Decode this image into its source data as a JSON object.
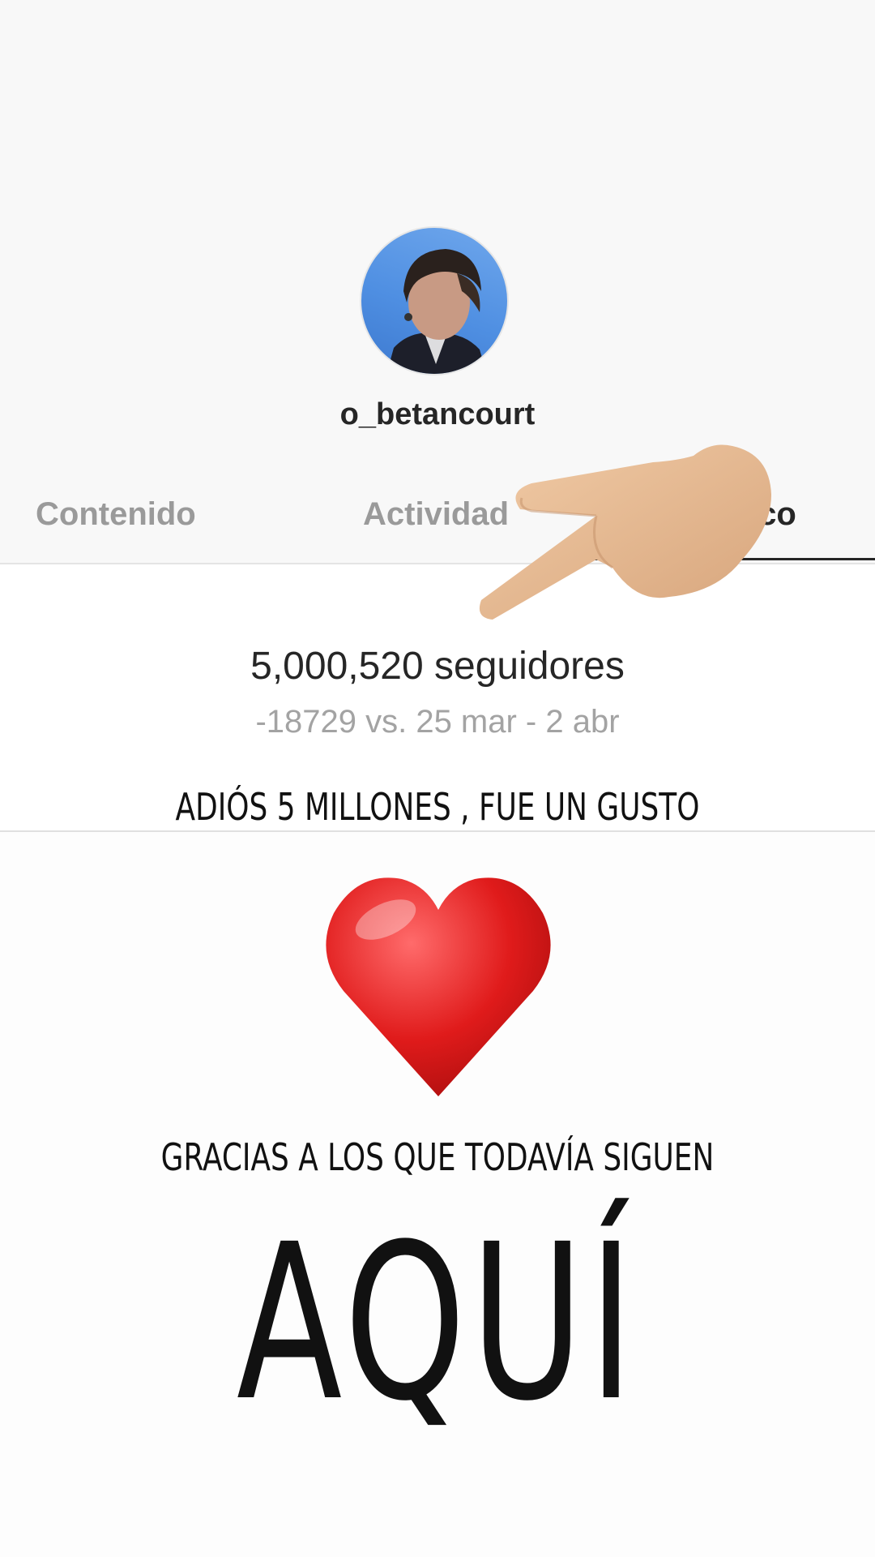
{
  "profile": {
    "username": "o_betancourt"
  },
  "tabs": [
    {
      "label": "Contenido",
      "active": false
    },
    {
      "label": "Actividad",
      "active": false
    },
    {
      "label": "ico",
      "active": true
    }
  ],
  "stats": {
    "followers": "5,000,520 seguidores",
    "change": "-18729 vs. 25 mar - 2 abr"
  },
  "story": {
    "line1": "ADIÓS 5 MILLONES , FUE UN GUSTO",
    "line2": "GRACIAS A LOS QUE TODAVÍA SIGUEN",
    "big": "AQUÍ"
  },
  "stickers": {
    "pointer": "pointing-hand-icon",
    "heart": "red-heart-icon"
  },
  "colors": {
    "heart": "#e01b1b",
    "skin": "#e3b68f",
    "text": "#111111"
  }
}
